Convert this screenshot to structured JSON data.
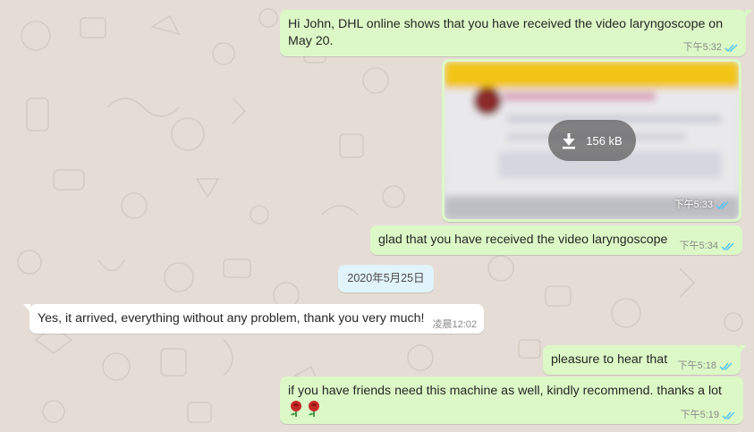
{
  "colors": {
    "outgoing_bubble": "#dcf8c6",
    "incoming_bubble": "#ffffff",
    "wallpaper": "#e5ddd5",
    "date_chip": "#e1f3fb",
    "read_ticks": "#4fc3f7"
  },
  "messages": [
    {
      "text": "Hi John, DHL online shows that you have received the video laryngoscope on May 20.",
      "time": "下午5:32",
      "status_icon": "double-check-read-icon"
    },
    {
      "image_download_size": "156 kB",
      "time": "下午5:33",
      "download_icon": "download-arrow-icon",
      "status_icon": "double-check-read-icon"
    },
    {
      "text": "glad that you have received the video laryngoscope",
      "time": "下午5:34",
      "status_icon": "double-check-read-icon"
    },
    {
      "text": "Yes, it arrived, everything without any problem, thank you very much!",
      "time": "凌晨12:02"
    },
    {
      "text": "pleasure to hear that",
      "time": "下午5:18",
      "status_icon": "double-check-read-icon"
    },
    {
      "text": "if you have friends need this machine as well, kindly recommend. thanks a lot",
      "emoji": [
        "rose-emoji",
        "rose-emoji"
      ],
      "time": "下午5:19",
      "status_icon": "double-check-read-icon"
    }
  ],
  "date_divider": "2020年5月25日"
}
